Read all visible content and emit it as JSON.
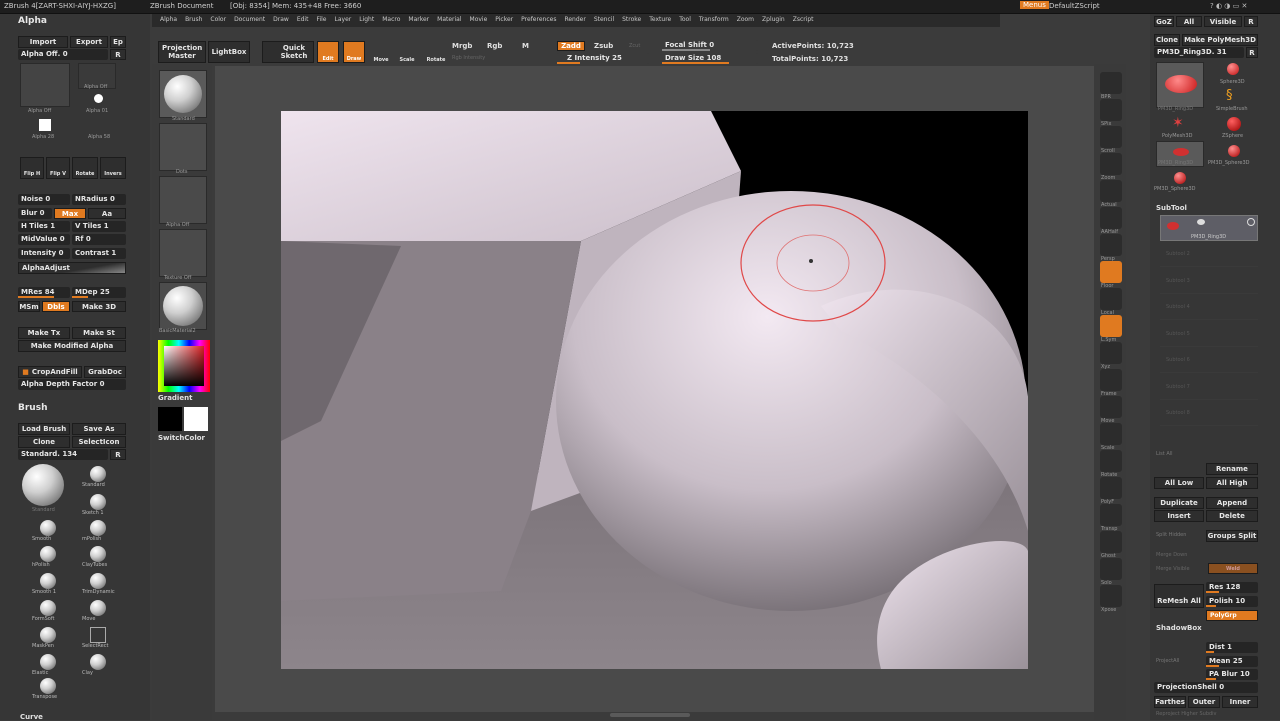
{
  "title": {
    "app": "ZBrush 4[ZART-SHXI-AIYJ-HXZG]",
    "doc": "ZBrush Document",
    "info": "[Obj: 8354] Mem: 435+48 Free: 3660",
    "menus_btn": "Menus",
    "script": "DefaultZScript"
  },
  "menubar": [
    "Alpha",
    "Brush",
    "Color",
    "Document",
    "Draw",
    "Edit",
    "File",
    "Layer",
    "Light",
    "Macro",
    "Marker",
    "Material",
    "Movie",
    "Picker",
    "Preferences",
    "Render",
    "Stencil",
    "Stroke",
    "Texture",
    "Tool",
    "Transform",
    "Zoom",
    "Zplugin",
    "Zscript"
  ],
  "toptoolbar": {
    "projection_master": "Projection Master",
    "lightbox": "LightBox",
    "quick_sketch": "Quick Sketch",
    "edit": "Edit",
    "draw": "Draw",
    "move": "Move",
    "scale": "Scale",
    "rotate": "Rotate",
    "mrgb": "Mrgb",
    "rgb": "Rgb",
    "m": "M",
    "rgb_intensity": "Rgb Intensity",
    "zadd": "Zadd",
    "zsub": "Zsub",
    "zcut": "Zcut",
    "z_intensity": "Z Intensity 25",
    "focal_shift": "Focal Shift 0",
    "draw_size": "Draw Size 108",
    "active_points": "ActivePoints: 10,723",
    "total_points": "TotalPoints: 10,723",
    "z_intensity_value": 0.25,
    "draw_size_value": 0.7
  },
  "alpha_panel": {
    "header": "Alpha",
    "import": "Import",
    "export": "Export",
    "ep": "Ep",
    "alpha_off": "Alpha Off. 0",
    "r": "R",
    "alpha_off_small": "Alpha Off",
    "alpha_01": "Alpha 01",
    "alpha_28": "Alpha 28",
    "alpha_58": "Alpha 58",
    "flip_h": "Flip H",
    "flip_v": "Flip V",
    "rotate": "Rotate",
    "invers": "Invers",
    "noise": "Noise 0",
    "nradius": "NRadius 0",
    "blur": "Blur 0",
    "max": "Max",
    "aa": "Aa",
    "h_tiles": "H Tiles 1",
    "v_tiles": "V Tiles 1",
    "midvalue": "MidValue 0",
    "rf": "Rf 0",
    "intensity": "Intensity 0",
    "contrast": "Contrast 1",
    "alpha_adjust": "AlphaAdjust",
    "mres": "MRes 84",
    "mdep": "MDep 25",
    "msm": "MSm",
    "dbls": "Dbls",
    "make_3d": "Make 3D",
    "make_tx": "Make Tx",
    "make_st": "Make St",
    "make_modified_alpha": "Make Modified Alpha",
    "crop_and_fill": "CropAndFill",
    "grab_doc": "GrabDoc",
    "alpha_depth_factor": "Alpha Depth Factor 0"
  },
  "brush_panel": {
    "header": "Brush",
    "load_brush": "Load Brush",
    "save_as": "Save As",
    "clone": "Clone",
    "select_icon": "SelectIcon",
    "current": "Standard. 134",
    "r": "R",
    "brushes": [
      "Standard",
      "Standard",
      "Sketch 1",
      "Smooth",
      "mPolish",
      "hPolish",
      "ClayTubes",
      "Smooth 1",
      "TrimDynamic",
      "FormSoft",
      "Move",
      "MaskPen",
      "SelectRect",
      "Elastic",
      "Clay",
      "Transpose"
    ],
    "curve": "Curve"
  },
  "shelf": {
    "standard": "Standard",
    "dots": "Dots",
    "alpha_off": "Alpha Off",
    "texture_off": "Texture Off",
    "basic_material": "BasicMaterial2",
    "gradient": "Gradient",
    "switch_color": "SwitchColor",
    "main_color": "#d81f22"
  },
  "right_toolbar": [
    "BPR",
    "SPix",
    "Scroll",
    "Zoom",
    "Actual",
    "AAHalf",
    "Persp",
    "Floor",
    "Local",
    "L.Sym",
    "Xyz",
    "Frame",
    "Move",
    "Scale",
    "Rotate",
    "PolyF",
    "Transp",
    "Ghost",
    "Solo",
    "Xpose"
  ],
  "tool_panel": {
    "goz": "GoZ",
    "all": "All",
    "visible": "Visible",
    "r": "R",
    "clone": "Clone",
    "make_polymesh3d": "Make PolyMesh3D",
    "current_tool": "PM3D_Ring3D. 31",
    "tools": [
      "PM3D_Ring3D",
      "Sphere3D",
      "SimpleBrush",
      "PolyMesh3D",
      "ZSphere",
      "PM3D_Ring3D",
      "PM3D_Sphere3D",
      "PM3D_Sphere3D"
    ],
    "subtool_header": "SubTool",
    "subtool_active": "PM3D_Ring3D",
    "empty_slots": [
      "Subtool 2",
      "Subtool 3",
      "Subtool 4",
      "Subtool 5",
      "Subtool 6",
      "Subtool 7",
      "Subtool 8"
    ],
    "list_all": "List All",
    "rename": "Rename",
    "all_low": "All Low",
    "all_high": "All High",
    "duplicate": "Duplicate",
    "append": "Append",
    "insert": "Insert",
    "delete": "Delete",
    "split_hidden": "Split Hidden",
    "groups_split": "Groups Split",
    "merge_down": "Merge Down",
    "merge_visible": "Merge Visible",
    "weld": "Weld",
    "remesh_all": "ReMesh All",
    "res": "Res 128",
    "polish": "Polish 10",
    "polygrp": "PolyGrp",
    "shadowbox": "ShadowBox",
    "project_all": "ProjectAll",
    "dist": "Dist 1",
    "mean": "Mean 25",
    "pa_blur": "PA Blur 10",
    "projection_shell": "ProjectionShell 0",
    "farthest": "Farthes",
    "outer": "Outer",
    "inner": "Inner",
    "reproject": "Reproject Higher Subdiv"
  }
}
